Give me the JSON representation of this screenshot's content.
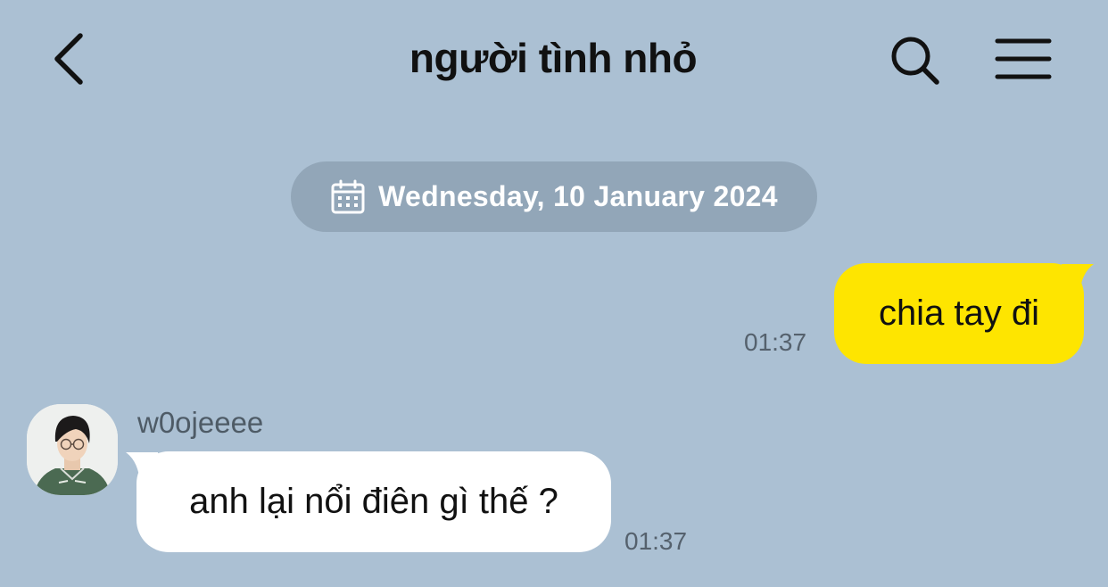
{
  "header": {
    "title": "người tình nhỏ",
    "back_icon": "chevron-left-icon",
    "search_icon": "search-icon",
    "menu_icon": "hamburger-menu-icon"
  },
  "date_divider": {
    "icon": "calendar-icon",
    "label": "Wednesday, 10 January 2024"
  },
  "messages": [
    {
      "direction": "outgoing",
      "text": "chia tay đi",
      "time": "01:37",
      "bubble_color": "#fee500"
    },
    {
      "direction": "incoming",
      "sender": "w0ojeeee",
      "text": "anh lại nổi điên gì thế ?",
      "time": "01:37",
      "bubble_color": "#ffffff"
    }
  ],
  "colors": {
    "background": "#abc0d3",
    "date_pill": "#92a6b8"
  }
}
